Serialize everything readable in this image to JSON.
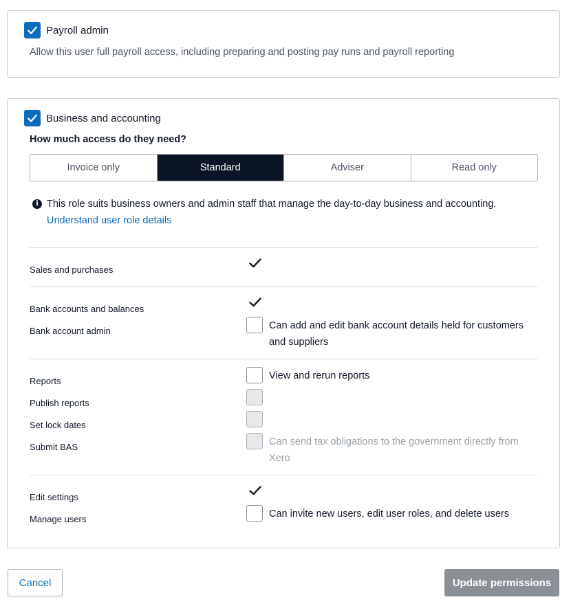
{
  "payroll": {
    "checked": true,
    "label": "Payroll admin",
    "description": "Allow this user full payroll access, including preparing and posting pay runs and payroll reporting"
  },
  "business": {
    "checked": true,
    "label": "Business and accounting",
    "question": "How much access do they need?",
    "access_levels": [
      "Invoice only",
      "Standard",
      "Adviser",
      "Read only"
    ],
    "selected_level": "Standard",
    "info_text": "This role suits business owners and admin staff that manage the day-to-day business and accounting.",
    "info_link": "Understand user role details",
    "permissions": [
      {
        "label": "Sales and purchases",
        "state": "granted",
        "text": ""
      },
      {
        "label": "Bank accounts and balances",
        "state": "granted",
        "text": ""
      },
      {
        "label": "Bank account admin",
        "state": "unchecked",
        "text": "Can add and edit bank account details held for customers and suppliers"
      },
      {
        "label": "Reports",
        "state": "unchecked",
        "text": "View and rerun reports"
      },
      {
        "label": "Publish reports",
        "state": "disabled",
        "text": ""
      },
      {
        "label": "Set lock dates",
        "state": "disabled",
        "text": ""
      },
      {
        "label": "Submit BAS",
        "state": "disabled",
        "text": "Can send tax obligations to the government directly from Xero"
      },
      {
        "label": "Edit settings",
        "state": "granted",
        "text": ""
      },
      {
        "label": "Manage users",
        "state": "unchecked",
        "text": "Can invite new users, edit user roles, and delete users"
      }
    ]
  },
  "actions": {
    "cancel_label": "Cancel",
    "update_label": "Update permissions"
  },
  "colors": {
    "accent": "#0c6bbd",
    "segment_active": "#0b1424",
    "update_button_disabled": "#8b9097"
  }
}
